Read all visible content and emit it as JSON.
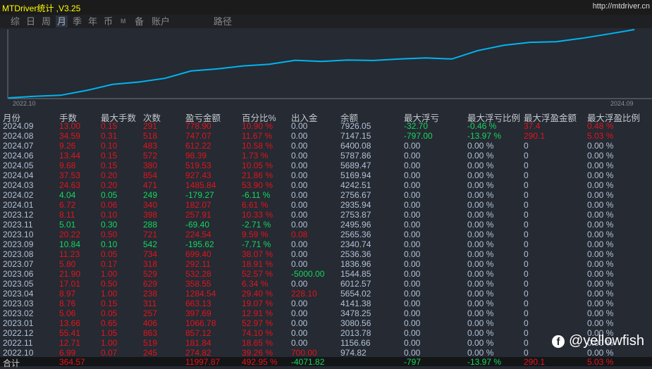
{
  "app": {
    "title": "MTDriver统计 ,V3.25",
    "url": "http://mtdriver.cn"
  },
  "tabs": [
    "综",
    "日",
    "周",
    "月",
    "季",
    "年",
    "币",
    "M",
    "备",
    "账户",
    "路径"
  ],
  "active_tab": "月",
  "chart": {
    "x_start": "2022.10",
    "x_end": "2024.09",
    "line_color": "#00b4f0"
  },
  "columns": [
    "月份",
    "手数",
    "最大手数",
    "次数",
    "盈亏金额",
    "百分比%",
    "出入金",
    "余额",
    "最大浮亏",
    "最大浮亏比例",
    "最大浮盈金额",
    "最大浮盈比例"
  ],
  "rows": [
    [
      "2024.09",
      "13.00",
      "0.15",
      "291",
      "778.90",
      "10.90 %",
      "0.00",
      "7926.05",
      "-32.70",
      "-0.46 %",
      "37.4",
      "0.48 %"
    ],
    [
      "2024.08",
      "34.59",
      "0.31",
      "518",
      "747.07",
      "11.67 %",
      "0.00",
      "7147.15",
      "-797.00",
      "-13.97 %",
      "290.1",
      "5.03 %"
    ],
    [
      "2024.07",
      "9.26",
      "0.10",
      "483",
      "612.22",
      "10.58 %",
      "0.00",
      "6400.08",
      "0.00",
      "0.00 %",
      "0",
      "0.00 %"
    ],
    [
      "2024.06",
      "13.44",
      "0.15",
      "572",
      "98.39",
      "1.73 %",
      "0.00",
      "5787.86",
      "0.00",
      "0.00 %",
      "0",
      "0.00 %"
    ],
    [
      "2024.05",
      "9.68",
      "0.15",
      "380",
      "519.53",
      "10.05 %",
      "0.00",
      "5689.47",
      "0.00",
      "0.00 %",
      "0",
      "0.00 %"
    ],
    [
      "2024.04",
      "37.53",
      "0.20",
      "854",
      "927.43",
      "21.86 %",
      "0.00",
      "5169.94",
      "0.00",
      "0.00 %",
      "0",
      "0.00 %"
    ],
    [
      "2024.03",
      "24.63",
      "0.20",
      "471",
      "1485.84",
      "53.90 %",
      "0.00",
      "4242.51",
      "0.00",
      "0.00 %",
      "0",
      "0.00 %"
    ],
    [
      "2024.02",
      "4.04",
      "0.05",
      "249",
      "-179.27",
      "-6.11 %",
      "0.00",
      "2756.67",
      "0.00",
      "0.00 %",
      "0",
      "0.00 %"
    ],
    [
      "2024.01",
      "6.72",
      "0.06",
      "340",
      "182.07",
      "6.61 %",
      "0.00",
      "2935.94",
      "0.00",
      "0.00 %",
      "0",
      "0.00 %"
    ],
    [
      "2023.12",
      "8.11",
      "0.10",
      "398",
      "257.91",
      "10.33 %",
      "0.00",
      "2753.87",
      "0.00",
      "0.00 %",
      "0",
      "0.00 %"
    ],
    [
      "2023.11",
      "5.01",
      "0.30",
      "288",
      "-69.40",
      "-2.71 %",
      "0.00",
      "2495.96",
      "0.00",
      "0.00 %",
      "0",
      "0.00 %"
    ],
    [
      "2023.10",
      "20.22",
      "0.50",
      "721",
      "224.54",
      "9.59 %",
      "0.08",
      "2565.36",
      "0.00",
      "0.00 %",
      "0",
      "0.00 %"
    ],
    [
      "2023.09",
      "10.84",
      "0.10",
      "542",
      "-195.62",
      "-7.71 %",
      "0.00",
      "2340.74",
      "0.00",
      "0.00 %",
      "0",
      "0.00 %"
    ],
    [
      "2023.08",
      "11.23",
      "0.05",
      "734",
      "699.40",
      "38.07 %",
      "0.00",
      "2536.36",
      "0.00",
      "0.00 %",
      "0",
      "0.00 %"
    ],
    [
      "2023.07",
      "5.80",
      "0.17",
      "318",
      "292.11",
      "18.91 %",
      "0.00",
      "1836.96",
      "0.00",
      "0.00 %",
      "0",
      "0.00 %"
    ],
    [
      "2023.06",
      "21.90",
      "1.00",
      "529",
      "532.28",
      "52.57 %",
      "-5000.00",
      "1544.85",
      "0.00",
      "0.00 %",
      "0",
      "0.00 %"
    ],
    [
      "2023.05",
      "17.01",
      "0.50",
      "629",
      "358.55",
      "6.34 %",
      "0.00",
      "6012.57",
      "0.00",
      "0.00 %",
      "0",
      "0.00 %"
    ],
    [
      "2023.04",
      "8.97",
      "1.00",
      "238",
      "1284.54",
      "29.40 %",
      "228.10",
      "5654.02",
      "0.00",
      "0.00 %",
      "0",
      "0.00 %"
    ],
    [
      "2023.03",
      "8.76",
      "0.15",
      "311",
      "663.13",
      "19.07 %",
      "0.00",
      "4141.38",
      "0.00",
      "0.00 %",
      "0",
      "0.00 %"
    ],
    [
      "2023.02",
      "5.06",
      "0.05",
      "257",
      "397.69",
      "12.91 %",
      "0.00",
      "3478.25",
      "0.00",
      "0.00 %",
      "0",
      "0.00 %"
    ],
    [
      "2023.01",
      "13.66",
      "0.65",
      "406",
      "1066.78",
      "52.97 %",
      "0.00",
      "3080.56",
      "0.00",
      "0.00 %",
      "0",
      "0.00 %"
    ],
    [
      "2022.12",
      "55.41",
      "1.05",
      "863",
      "857.12",
      "74.10 %",
      "0.00",
      "2013.78",
      "0.00",
      "0.00 %",
      "0",
      "0.00 %"
    ],
    [
      "2022.11",
      "12.71",
      "1.00",
      "519",
      "181.84",
      "18.65 %",
      "0.00",
      "1156.66",
      "0.00",
      "0.00 %",
      "0",
      "0.00 %"
    ],
    [
      "2022.10",
      "6.99",
      "0.07",
      "245",
      "274.82",
      "39.26 %",
      "700.00",
      "974.82",
      "0.00",
      "0.00 %",
      "0",
      "0.00 %"
    ]
  ],
  "total": [
    "合计",
    "364.57",
    "",
    "",
    "11997.87",
    "492.95 %",
    "-4071.82",
    "",
    "-797",
    "-13.97 %",
    "290.1",
    "5.03 %"
  ],
  "watermark": "@yellowfish",
  "colors": {
    "profit": "#e3141b",
    "loss": "#17d65c",
    "neutral": "#b3c2d6"
  }
}
